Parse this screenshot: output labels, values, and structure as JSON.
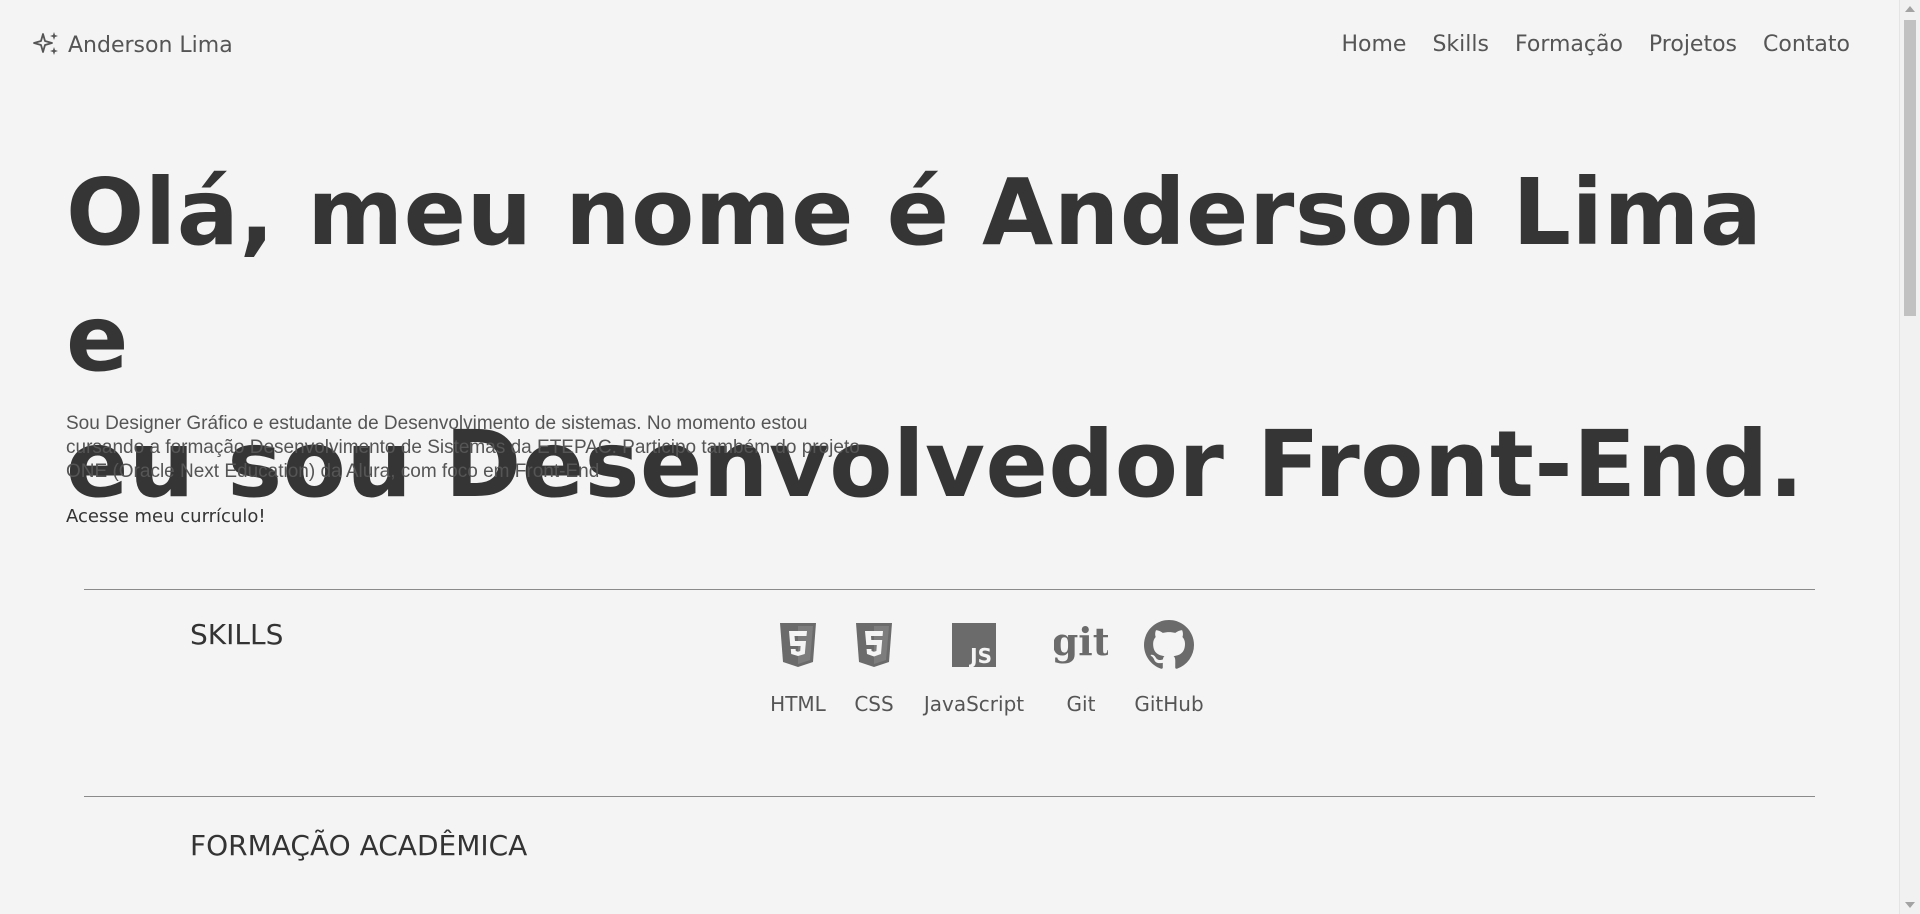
{
  "header": {
    "logo_icon": "sparkles-icon",
    "logo_text": "Anderson Lima",
    "nav": [
      "Home",
      "Skills",
      "Formação",
      "Projetos",
      "Contato"
    ]
  },
  "hero": {
    "title_line1": "Olá, meu nome é Anderson Lima e",
    "title_line2": "eu sou Desenvolvedor Front-End.",
    "desc_line1": "Sou Designer Gráfico e estudante de Desenvolvimento de sistemas. No momento estou",
    "desc_line2": "cursando a formação Desenvolvimento de Sistemas da ETEPAC. Participo também do projeto",
    "desc_line3": "ONE (Oracle Next Education) da Alura, com foco em Front-End",
    "cv_link": "Acesse meu currículo!"
  },
  "skills": {
    "title": "SKILLS",
    "items": [
      {
        "label": "HTML",
        "icon": "html5-icon"
      },
      {
        "label": "CSS",
        "icon": "css3-icon"
      },
      {
        "label": "JavaScript",
        "icon": "javascript-icon"
      },
      {
        "label": "Git",
        "icon": "git-icon"
      },
      {
        "label": "GitHub",
        "icon": "github-icon"
      }
    ]
  },
  "formacao": {
    "title": "FORMAÇÃO ACADÊMICA"
  },
  "colors": {
    "background": "#f4f4f4",
    "text": "#333333",
    "icon": "#666666"
  }
}
